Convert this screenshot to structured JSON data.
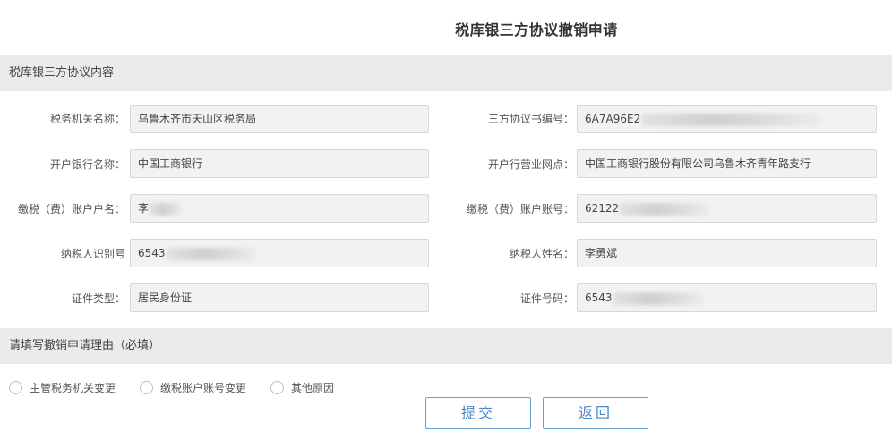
{
  "page_title": "税库银三方协议撤销申请",
  "section1_title": "税库银三方协议内容",
  "section2_title": "请填写撤销申请理由（必填）",
  "fields": {
    "tax_authority": {
      "label": "税务机关名称：",
      "value": "乌鲁木齐市天山区税务局"
    },
    "agreement_no": {
      "label": "三方协议书编号：",
      "value": "6A7A96E2"
    },
    "bank_name": {
      "label": "开户银行名称：",
      "value": "中国工商银行"
    },
    "bank_branch": {
      "label": "开户行营业网点：",
      "value": "中国工商银行股份有限公司乌鲁木齐青年路支行"
    },
    "account_name": {
      "label": "缴税（费）账户户名：",
      "value": "李"
    },
    "account_no": {
      "label": "缴税（费）账户账号：",
      "value": "62122"
    },
    "taxpayer_id": {
      "label": "纳税人识别号",
      "value": "6543"
    },
    "taxpayer_name": {
      "label": "纳税人姓名：",
      "value": "李勇斌"
    },
    "id_type": {
      "label": "证件类型：",
      "value": "居民身份证"
    },
    "id_no": {
      "label": "证件号码：",
      "value": "6543"
    }
  },
  "reasons": [
    "主管税务机关变更",
    "缴税账户账号变更",
    "其他原因"
  ],
  "buttons": {
    "submit": "提交",
    "back": "返回"
  }
}
